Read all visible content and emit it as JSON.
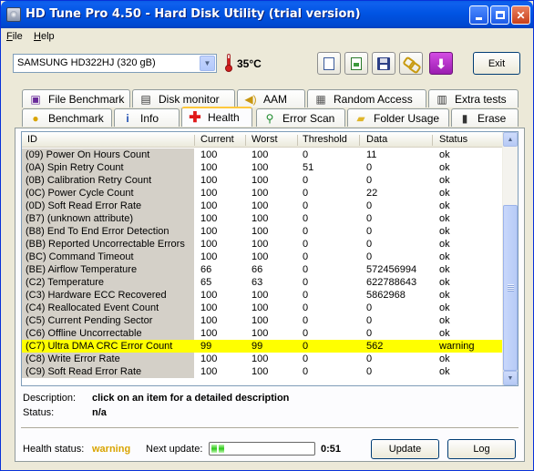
{
  "window": {
    "title": "HD Tune Pro 4.50 - Hard Disk Utility (trial version)"
  },
  "menu": {
    "file": "File",
    "file_u": "F",
    "file_rest": "ile",
    "help_u": "H",
    "help_rest": "elp"
  },
  "toolbar": {
    "drive": "SAMSUNG HD322HJ (320 gB)",
    "temperature": "35°C",
    "exit_label": "Exit"
  },
  "tabs_top": [
    {
      "label": "File Benchmark"
    },
    {
      "label": "Disk monitor"
    },
    {
      "label": "AAM"
    },
    {
      "label": "Random Access"
    },
    {
      "label": "Extra tests"
    }
  ],
  "tabs_bottom": [
    {
      "label": "Benchmark"
    },
    {
      "label": "Info"
    },
    {
      "label": "Health",
      "active": true
    },
    {
      "label": "Error Scan"
    },
    {
      "label": "Folder Usage"
    },
    {
      "label": "Erase"
    }
  ],
  "table": {
    "columns": [
      "ID",
      "Current",
      "Worst",
      "Threshold",
      "Data",
      "Status"
    ],
    "rows": [
      [
        "(09) Power On Hours Count",
        "100",
        "100",
        "0",
        "11",
        "ok"
      ],
      [
        "(0A) Spin Retry Count",
        "100",
        "100",
        "51",
        "0",
        "ok"
      ],
      [
        "(0B) Calibration Retry Count",
        "100",
        "100",
        "0",
        "0",
        "ok"
      ],
      [
        "(0C) Power Cycle Count",
        "100",
        "100",
        "0",
        "22",
        "ok"
      ],
      [
        "(0D) Soft Read Error Rate",
        "100",
        "100",
        "0",
        "0",
        "ok"
      ],
      [
        "(B7) (unknown attribute)",
        "100",
        "100",
        "0",
        "0",
        "ok"
      ],
      [
        "(B8) End To End Error Detection",
        "100",
        "100",
        "0",
        "0",
        "ok"
      ],
      [
        "(BB) Reported Uncorrectable Errors",
        "100",
        "100",
        "0",
        "0",
        "ok"
      ],
      [
        "(BC) Command Timeout",
        "100",
        "100",
        "0",
        "0",
        "ok"
      ],
      [
        "(BE) Airflow Temperature",
        "66",
        "66",
        "0",
        "572456994",
        "ok"
      ],
      [
        "(C2) Temperature",
        "65",
        "63",
        "0",
        "622788643",
        "ok"
      ],
      [
        "(C3) Hardware ECC Recovered",
        "100",
        "100",
        "0",
        "5862968",
        "ok"
      ],
      [
        "(C4) Reallocated Event Count",
        "100",
        "100",
        "0",
        "0",
        "ok"
      ],
      [
        "(C5) Current Pending Sector",
        "100",
        "100",
        "0",
        "0",
        "ok"
      ],
      [
        "(C6) Offline Uncorrectable",
        "100",
        "100",
        "0",
        "0",
        "ok"
      ],
      [
        "(C7) Ultra DMA CRC Error Count",
        "99",
        "99",
        "0",
        "562",
        "warning"
      ],
      [
        "(C8) Write Error Rate",
        "100",
        "100",
        "0",
        "0",
        "ok"
      ],
      [
        "(C9) Soft Read Error Rate",
        "100",
        "100",
        "0",
        "0",
        "ok"
      ]
    ],
    "highlight_color": "#ffff00"
  },
  "details": {
    "description_label": "Description:",
    "description_value": "click on an item for a detailed description",
    "status_label": "Status:",
    "status_value": "n/a"
  },
  "footer": {
    "health_label": "Health status:",
    "health_value": "warning",
    "next_update_label": "Next update:",
    "next_update_progress": 0.17,
    "countdown": "0:51",
    "update_label": "Update",
    "log_label": "Log"
  },
  "colors": {
    "title_bar": "#0054e3",
    "warning_text": "#d9a400",
    "accent_tab": "#ffc83c"
  }
}
